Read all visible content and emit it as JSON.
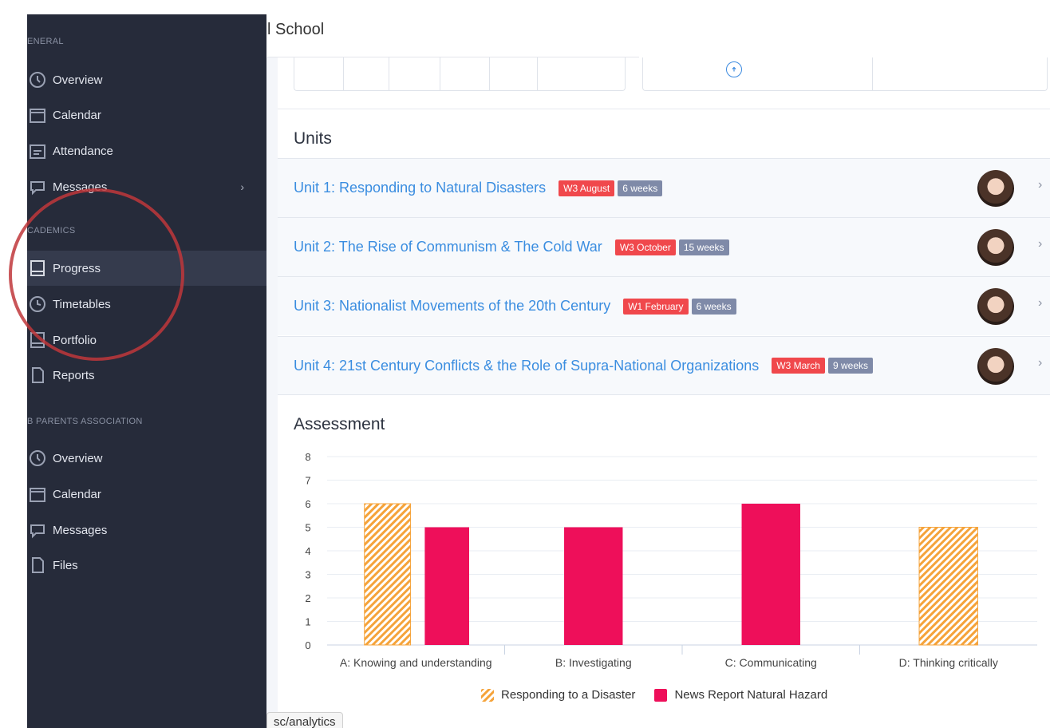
{
  "header": {
    "title": "l School"
  },
  "sidebar": {
    "sections": [
      {
        "label": "ENERAL"
      },
      {
        "label": "CADEMICS"
      },
      {
        "label": "B PARENTS ASSOCIATION"
      }
    ],
    "items": [
      {
        "label": "Overview",
        "icon": "overview-icon"
      },
      {
        "label": "Calendar",
        "icon": "calendar-icon"
      },
      {
        "label": "Attendance",
        "icon": "attendance-icon"
      },
      {
        "label": "Messages",
        "icon": "messages-icon",
        "chevron": "›"
      },
      {
        "label": "Progress",
        "icon": "progress-icon",
        "active": true
      },
      {
        "label": "Timetables",
        "icon": "timetables-icon"
      },
      {
        "label": "Portfolio",
        "icon": "portfolio-icon"
      },
      {
        "label": "Reports",
        "icon": "reports-icon"
      },
      {
        "label": "Overview",
        "icon": "overview-icon"
      },
      {
        "label": "Calendar",
        "icon": "calendar-icon"
      },
      {
        "label": "Messages",
        "icon": "messages-icon"
      },
      {
        "label": "Files",
        "icon": "files-icon"
      }
    ]
  },
  "units": {
    "title": "Units",
    "rows": [
      {
        "name": "Unit 1: Responding to Natural Disasters",
        "start": "W3 August",
        "duration": "6 weeks"
      },
      {
        "name": "Unit 2: The Rise of Communism & The Cold War",
        "start": "W3 October",
        "duration": "15 weeks"
      },
      {
        "name": "Unit 3: Nationalist Movements of the 20th Century",
        "start": "W1 February",
        "duration": "6 weeks"
      },
      {
        "name": "Unit 4: 21st Century Conflicts & the Role of Supra-National Organizations",
        "start": "W3 March",
        "duration": "9 weeks"
      }
    ],
    "chevron": "›"
  },
  "assessment": {
    "title": "Assessment"
  },
  "chart_data": {
    "type": "bar",
    "title": "",
    "categories": [
      "A: Knowing and understanding",
      "B: Investigating",
      "C: Communicating",
      "D: Thinking critically"
    ],
    "series": [
      {
        "name": "Responding to a Disaster",
        "values": [
          6,
          null,
          null,
          5
        ],
        "color": "#f5a33a",
        "pattern": "hatched"
      },
      {
        "name": "News Report Natural Hazard",
        "values": [
          5,
          5,
          6,
          null
        ],
        "color": "#ee0f5a"
      }
    ],
    "ylim": [
      0,
      8
    ],
    "yticks": [
      0,
      1,
      2,
      3,
      4,
      5,
      6,
      7,
      8
    ],
    "grid": true,
    "legend": "bottom"
  },
  "tooltip": {
    "url": "sc/analytics"
  },
  "colors": {
    "sidebar_bg": "#262b3a",
    "link": "#3a8de0",
    "badge_red": "#f0484c",
    "badge_gray": "#7f8aa8",
    "annotation": "#c0373b"
  }
}
